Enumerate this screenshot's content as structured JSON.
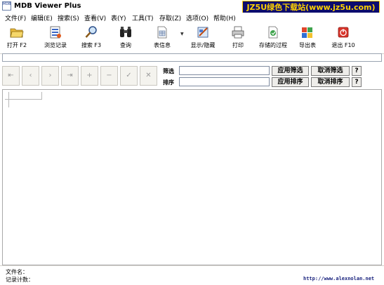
{
  "window": {
    "title": "MDB Viewer Plus",
    "icon_text": "MDB"
  },
  "watermark": {
    "text": "JZ5U绿色下载站(www.jz5u.com)"
  },
  "menu": {
    "items": [
      {
        "label": "文件(F)"
      },
      {
        "label": "编辑(E)"
      },
      {
        "label": "搜索(S)"
      },
      {
        "label": "查看(V)"
      },
      {
        "label": "表(Y)"
      },
      {
        "label": "工具(T)"
      },
      {
        "label": "存取(Z)"
      },
      {
        "label": "选项(O)"
      },
      {
        "label": "帮助(H)"
      }
    ]
  },
  "toolbar": {
    "buttons": [
      {
        "label": "打开 F2",
        "icon": "folder-open-icon"
      },
      {
        "label": "浏览记录",
        "icon": "browse-records-icon"
      },
      {
        "label": "搜索 F3",
        "icon": "search-icon"
      },
      {
        "label": "查询",
        "icon": "binoculars-icon"
      },
      {
        "label": "表信息",
        "icon": "table-info-icon"
      },
      {
        "label": "显示/隐藏",
        "icon": "show-hide-icon"
      },
      {
        "label": "打印",
        "icon": "printer-icon"
      },
      {
        "label": "存储的过程",
        "icon": "stored-procedure-icon"
      },
      {
        "label": "导出表",
        "icon": "export-table-icon"
      },
      {
        "label": "退出 F10",
        "icon": "exit-icon"
      }
    ]
  },
  "filter": {
    "filter_label": "筛选",
    "sort_label": "排序",
    "filter_value": "",
    "sort_value": "",
    "apply_filter": "应用筛选",
    "cancel_filter": "取消筛选",
    "apply_sort": "应用排序",
    "cancel_sort": "取消排序",
    "help": "?"
  },
  "status": {
    "filename_label": "文件名：",
    "record_count_label": "记录计数：",
    "url": "http://www.alexnolan.net"
  }
}
